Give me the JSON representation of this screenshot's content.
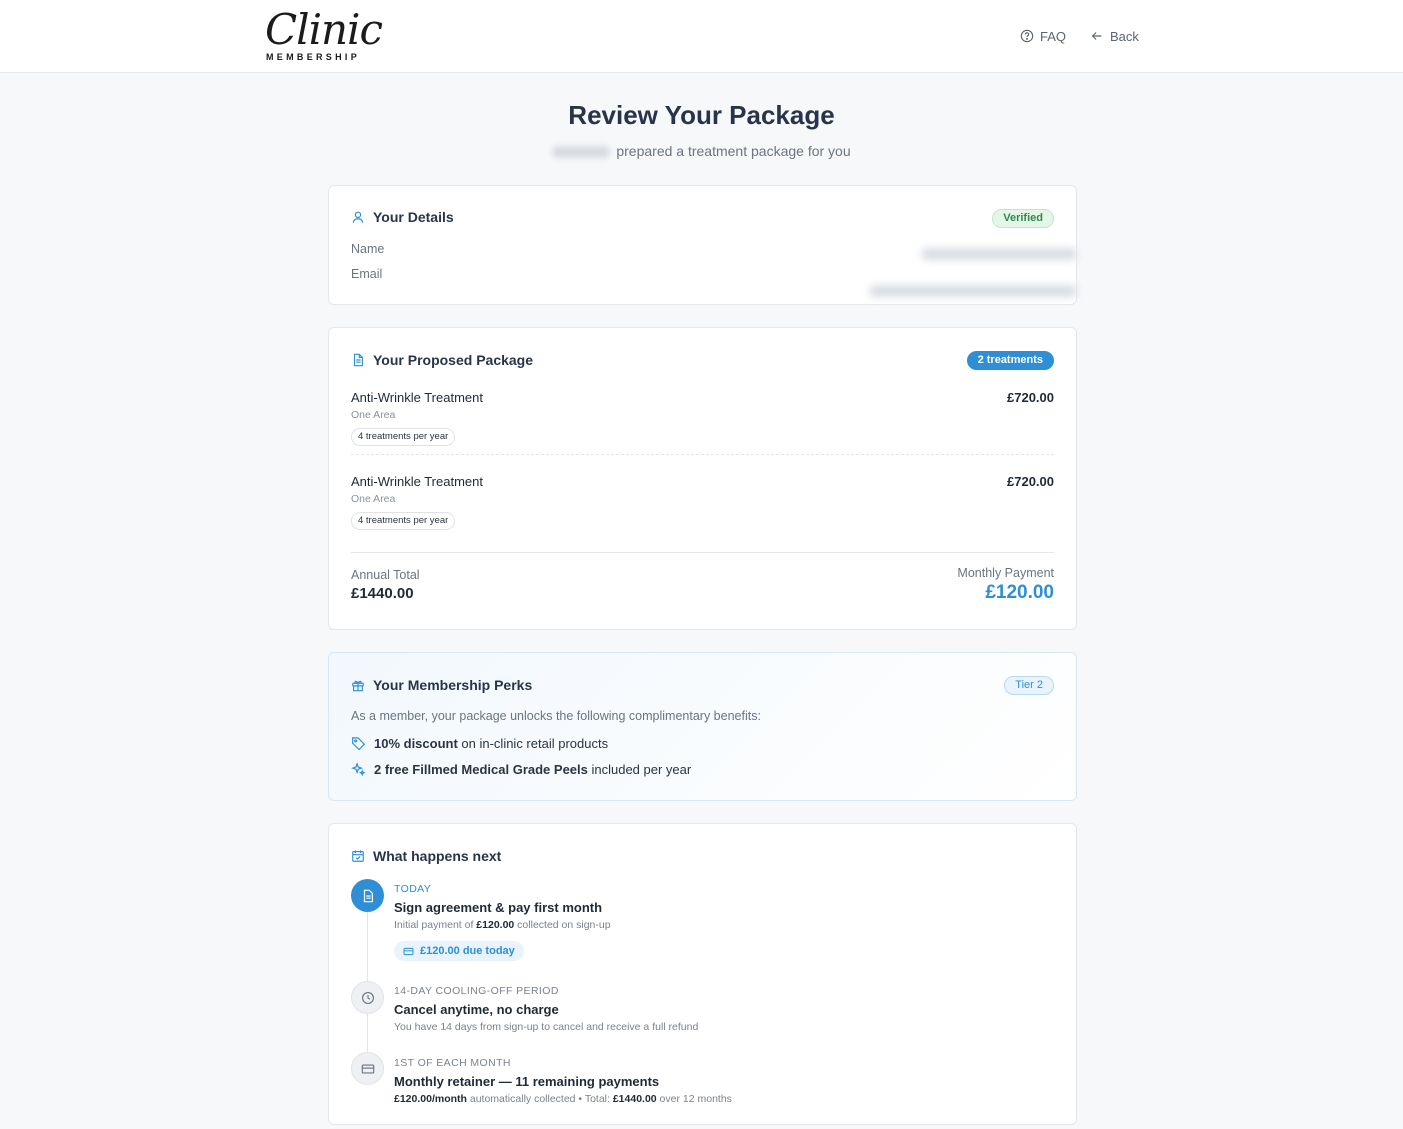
{
  "header": {
    "logo_script": "Clinic",
    "logo_sub": "MEMBERSHIP",
    "faq_label": "FAQ",
    "back_label": "Back"
  },
  "page": {
    "title": "Review Your Package",
    "subtitle": "prepared a treatment package for you"
  },
  "details": {
    "title": "Your Details",
    "badge": "Verified",
    "name_label": "Name",
    "email_label": "Email"
  },
  "package": {
    "title": "Your Proposed Package",
    "badge": "2 treatments",
    "items": [
      {
        "name": "Anti-Wrinkle Treatment",
        "area": "One Area",
        "frequency": "4 treatments per year",
        "price": "£720.00"
      },
      {
        "name": "Anti-Wrinkle Treatment",
        "area": "One Area",
        "frequency": "4 treatments per year",
        "price": "£720.00"
      }
    ],
    "annual_label": "Annual Total",
    "annual_value": "£1440.00",
    "monthly_label": "Monthly Payment",
    "monthly_value": "£120.00"
  },
  "perks": {
    "title": "Your Membership Perks",
    "badge": "Tier 2",
    "intro": "As a member, your package unlocks the following complimentary benefits:",
    "items": [
      {
        "bold": "10% discount",
        "rest": " on in-clinic retail products"
      },
      {
        "bold": "2 free Fillmed Medical Grade Peels",
        "rest": " included per year"
      }
    ]
  },
  "next": {
    "title": "What happens next",
    "steps": [
      {
        "label": "TODAY",
        "head": "Sign agreement & pay first month",
        "desc_pre": "Initial payment of ",
        "desc_bold": "£120.00",
        "desc_post": " collected on sign-up",
        "chip": "£120.00 due today"
      },
      {
        "label": "14-DAY COOLING-OFF PERIOD",
        "head": "Cancel anytime, no charge",
        "desc": "You have 14 days from sign-up to cancel and receive a full refund"
      },
      {
        "label": "1ST OF EACH MONTH",
        "head": "Monthly retainer — 11 remaining payments",
        "desc_bold1": "£120.00/month",
        "desc_mid": " automatically collected • Total: ",
        "desc_bold2": "£1440.00",
        "desc_post": " over 12 months"
      }
    ]
  },
  "colors": {
    "accent": "#2e8fd6",
    "verified_bg": "#e3f6e8",
    "verified_text": "#2f8a4a"
  }
}
